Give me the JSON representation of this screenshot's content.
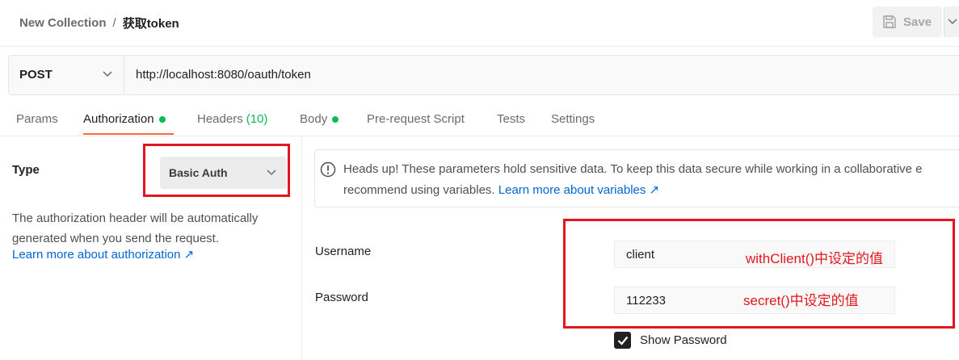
{
  "header": {
    "breadcrumb_parent": "New Collection",
    "breadcrumb_sep": "/",
    "breadcrumb_current": "获取token",
    "save_label": "Save"
  },
  "request": {
    "method": "POST",
    "url": "http://localhost:8080/oauth/token"
  },
  "tabs": [
    {
      "label": "Params"
    },
    {
      "label": "Authorization",
      "active": true,
      "dot": true
    },
    {
      "label": "Headers",
      "count": "(10)"
    },
    {
      "label": "Body",
      "dot": true
    },
    {
      "label": "Pre-request Script"
    },
    {
      "label": "Tests"
    },
    {
      "label": "Settings"
    }
  ],
  "auth": {
    "type_label": "Type",
    "type_value": "Basic Auth",
    "description_line1": "The authorization header will be automatically",
    "description_line2": "generated when you send the request.",
    "learn_link": "Learn more about authorization ↗"
  },
  "info": {
    "line1": "Heads up! These parameters hold sensitive data. To keep this data secure while working in a collaborative e",
    "line2_prefix": "recommend using variables. ",
    "line2_link": "Learn more about variables ↗"
  },
  "credentials": {
    "username_label": "Username",
    "username_value": "client",
    "username_note": "withClient()中设定的值",
    "password_label": "Password",
    "password_value": "112233",
    "password_note": "secret()中设定的值",
    "show_password_label": "Show Password",
    "show_password_checked": true
  },
  "colors": {
    "accent": "#ff6c37",
    "status_green": "#0cbb52",
    "link": "#0265d2",
    "annotation_red": "#e3161d"
  }
}
